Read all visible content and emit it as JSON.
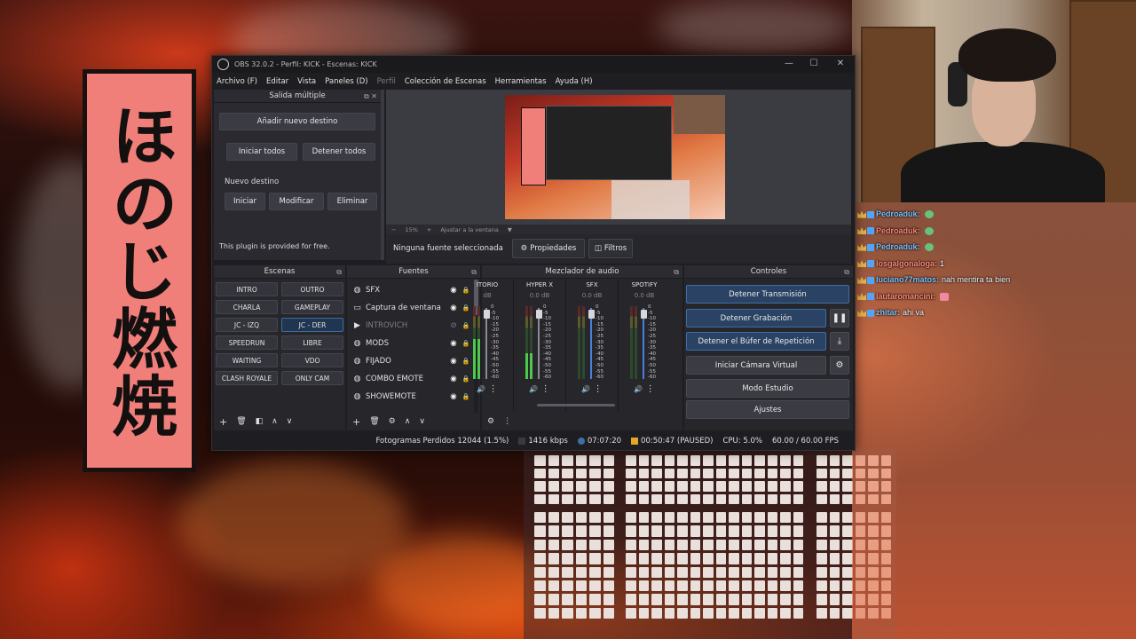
{
  "obs": {
    "title": "OBS 32.0.2 - Perfil: KICK - Escenas: KICK",
    "menu": [
      "Archivo (F)",
      "Editar",
      "Vista",
      "Paneles (D)",
      "Perfil",
      "Colección de Escenas",
      "Herramientas",
      "Ayuda (H)"
    ],
    "multi_output": {
      "title": "Salida múltiple",
      "add_destination": "Añadir nuevo destino",
      "start_all": "Iniciar todos",
      "stop_all": "Detener todos",
      "new_destination_label": "Nuevo destino",
      "start": "Iniciar",
      "modify": "Modificar",
      "delete": "Eliminar",
      "plugin_note": "This plugin is provided for free."
    },
    "zoom": {
      "percent": "15%",
      "fit_label": "Ajustar a la ventana"
    },
    "context": {
      "no_source": "Ninguna fuente seleccionada",
      "properties": "Propiedades",
      "filters": "Filtros"
    },
    "scenes": {
      "title": "Escenas",
      "items": [
        "INTRO",
        "OUTRO",
        "CHARLA",
        "GAMEPLAY",
        "JC - IZQ",
        "JC - DER",
        "SPEEDRUN",
        "LIBRE",
        "WAITING",
        "VDO",
        "CLASH ROYALE",
        "ONLY CAM"
      ],
      "active": "JC - DER"
    },
    "sources": {
      "title": "Fuentes",
      "items": [
        {
          "name": "SFX",
          "icon": "globe-icon",
          "visible": true
        },
        {
          "name": "Captura de ventana",
          "icon": "window-icon",
          "visible": true
        },
        {
          "name": "INTROVICH",
          "icon": "play-icon",
          "visible": false
        },
        {
          "name": "MODS",
          "icon": "globe-icon",
          "visible": true
        },
        {
          "name": "FIJADO",
          "icon": "globe-icon",
          "visible": true
        },
        {
          "name": "COMBO EMOTE",
          "icon": "globe-icon",
          "visible": true
        },
        {
          "name": "SHOWEMOTE",
          "icon": "globe-icon",
          "visible": true
        }
      ]
    },
    "mixer": {
      "title": "Mezclador de audio",
      "channels": [
        {
          "name": "ITORIO",
          "db": "dB"
        },
        {
          "name": "HYPER X",
          "db": "0.0 dB"
        },
        {
          "name": "SFX",
          "db": "0.0 dB"
        },
        {
          "name": "SPOTIFY",
          "db": "0.0 dB"
        }
      ],
      "scale": [
        "0",
        "-5",
        "-10",
        "-15",
        "-20",
        "-25",
        "-30",
        "-35",
        "-40",
        "-45",
        "-50",
        "-55",
        "-60"
      ]
    },
    "controls": {
      "title": "Controles",
      "stop_stream": "Detener Transmisión",
      "stop_recording": "Detener Grabación",
      "stop_replay": "Detener el Búfer de Repetición",
      "start_virtual_cam": "Iniciar Cámara Virtual",
      "studio_mode": "Modo Estudio",
      "settings": "Ajustes"
    },
    "status": {
      "dropped_frames": "Fotogramas Perdidos 12044 (1.5%)",
      "bitrate": "1416 kbps",
      "stream_time": "07:07:20",
      "record_time": "00:50:47 (PAUSED)",
      "cpu": "CPU: 5.0%",
      "fps": "60.00 / 60.00 FPS"
    }
  },
  "overlay": {
    "banner_text": "ほのじ燃焼"
  },
  "chat": [
    {
      "user": "Pedroaduk:",
      "msg": ""
    },
    {
      "user": "Pedroaduk:",
      "msg": ""
    },
    {
      "user": "Pedroaduk:",
      "msg": ""
    },
    {
      "user": "losgalgonaloga:",
      "msg": "1"
    },
    {
      "user": "luciano77matos:",
      "msg": "nah mentira ta bien"
    },
    {
      "user": "lautaromancini:",
      "msg": ""
    },
    {
      "user": "zhitar:",
      "msg": "ahi va"
    }
  ],
  "colors": {
    "accent": "#3d6ea6",
    "meter_green": "#4cc94c",
    "meter_yellow": "#d7d04a",
    "meter_red": "#d14a4a",
    "fader_blue": "#4a7fd8"
  }
}
